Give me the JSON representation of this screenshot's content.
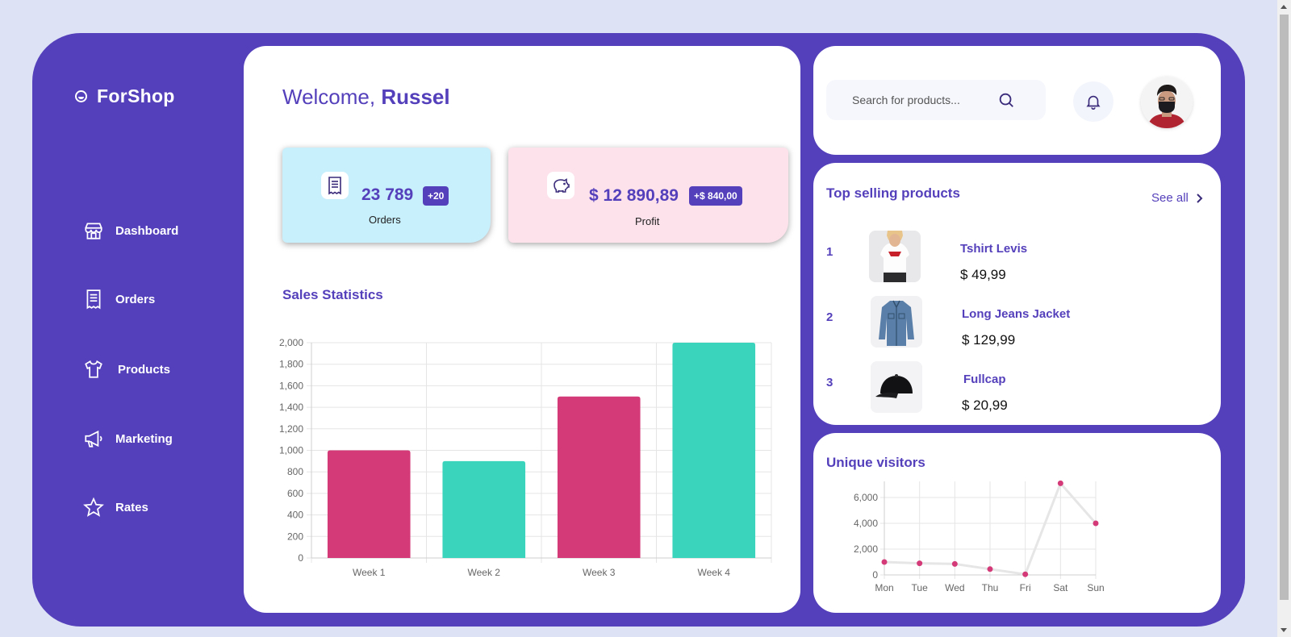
{
  "app": {
    "brand": "ForShop"
  },
  "sidebar": {
    "items": [
      {
        "label": "Dashboard",
        "icon": "store-icon"
      },
      {
        "label": "Orders",
        "icon": "receipt-icon"
      },
      {
        "label": "Products",
        "icon": "tshirt-icon"
      },
      {
        "label": "Marketing",
        "icon": "megaphone-icon"
      },
      {
        "label": "Rates",
        "icon": "star-icon"
      }
    ]
  },
  "welcome": {
    "greeting": "Welcome, ",
    "name": "Russel"
  },
  "stats": {
    "orders": {
      "value": "23 789",
      "badge": "+20",
      "label": "Orders",
      "icon": "receipt-icon"
    },
    "profit": {
      "value": "$ 12 890,89",
      "badge": "+$ 840,00",
      "label": "Profit",
      "icon": "piggy-bank-icon"
    }
  },
  "sales": {
    "title": "Sales Statistics"
  },
  "search": {
    "placeholder": "Search for products..."
  },
  "top_products": {
    "title": "Top selling products",
    "see_all": "See all",
    "items": [
      {
        "rank": "1",
        "name": "Tshirt Levis",
        "price": "$ 49,99"
      },
      {
        "rank": "2",
        "name": "Long Jeans Jacket",
        "price": "$ 129,99"
      },
      {
        "rank": "3",
        "name": "Fullcap",
        "price": "$ 20,99"
      }
    ]
  },
  "visitors": {
    "title": "Unique visitors"
  },
  "colors": {
    "brand": "#5540bb",
    "pink": "#d33a77",
    "teal": "#3ad3bc",
    "orders_bg": "#c8effc",
    "profit_bg": "#fde2ec"
  },
  "chart_data": [
    {
      "type": "bar",
      "title": "Sales Statistics",
      "categories": [
        "Week 1",
        "Week 2",
        "Week 3",
        "Week 4"
      ],
      "values": [
        1000,
        900,
        1500,
        2000
      ],
      "colors": [
        "#d33a77",
        "#3ad3bc",
        "#d33a77",
        "#3ad3bc"
      ],
      "ylim": [
        0,
        2000
      ],
      "yticks": [
        0,
        200,
        400,
        600,
        800,
        1000,
        1200,
        1400,
        1600,
        1800,
        2000
      ],
      "ytick_labels": [
        "0",
        "200",
        "400",
        "600",
        "800",
        "1,000",
        "1,200",
        "1,400",
        "1,600",
        "1,800",
        "2,000"
      ],
      "grid": true
    },
    {
      "type": "line",
      "title": "Unique visitors",
      "x": [
        "Mon",
        "Tue",
        "Wed",
        "Thu",
        "Fri",
        "Sat",
        "Sun"
      ],
      "values": [
        1000,
        900,
        850,
        450,
        50,
        7100,
        4000
      ],
      "ylim": [
        0,
        7000
      ],
      "yticks": [
        0,
        2000,
        4000,
        6000
      ],
      "ytick_labels": [
        "0",
        "2,000",
        "4,000",
        "6,000"
      ],
      "line_color": "#e6e6e6",
      "point_color": "#d33a77",
      "grid": true
    }
  ]
}
